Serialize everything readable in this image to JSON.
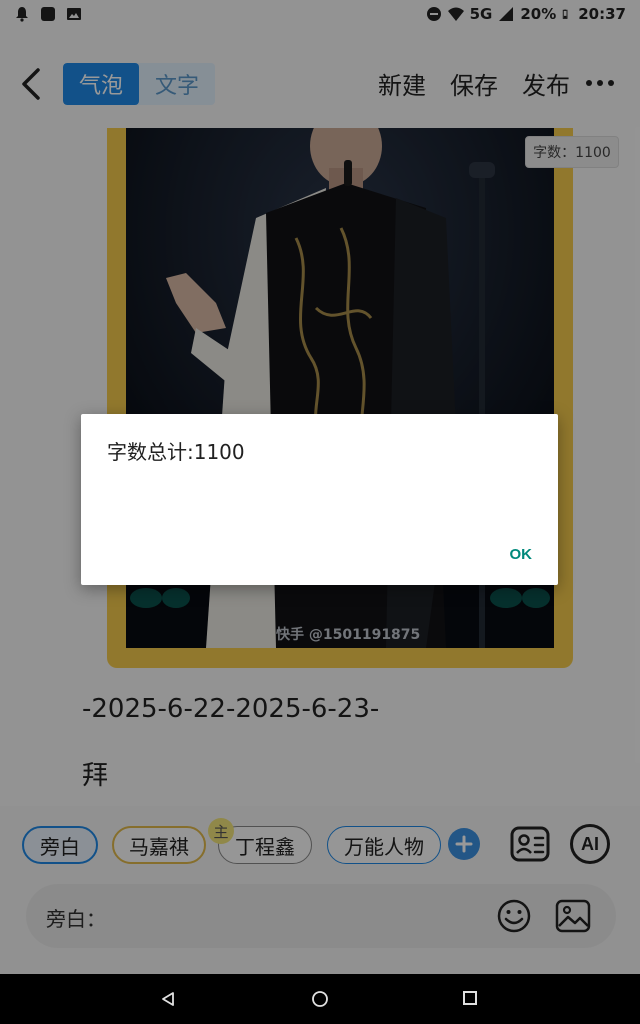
{
  "status_bar": {
    "network": "5G",
    "battery": "20%",
    "time": "20:37",
    "left_icons": [
      "notification-bell-icon",
      "square-app-icon",
      "gallery-icon"
    ],
    "right_icons": [
      "dnd-icon",
      "wifi-icon",
      "signal-icon",
      "battery-icon"
    ]
  },
  "top_bar": {
    "back_icon": "chevron-left-icon",
    "tabs": [
      {
        "label": "气泡",
        "active": true
      },
      {
        "label": "文字",
        "active": false
      }
    ],
    "actions": [
      {
        "label": "新建"
      },
      {
        "label": "保存"
      },
      {
        "label": "发布"
      }
    ],
    "more_icon": "more-horizontal-icon"
  },
  "photo": {
    "credit": "快手 @1501191875",
    "word_count_badge": "字数：1100"
  },
  "content": {
    "date_line": "-2025-6-22-2025-6-23-",
    "char_line": "拜"
  },
  "characters": {
    "chips": [
      {
        "label": "旁白"
      },
      {
        "label": "马嘉祺"
      },
      {
        "label": "丁程鑫",
        "badge": "主"
      },
      {
        "label": "万能人物"
      }
    ],
    "add_icon": "plus-icon",
    "contact_icon": "contact-card-icon",
    "ai_label": "AI"
  },
  "input": {
    "label": "旁白：",
    "emoji_icon": "emoji-icon",
    "image_icon": "image-icon"
  },
  "dialog": {
    "message": "字数总计:1100",
    "ok_label": "OK"
  },
  "nav_bar": {
    "icons": [
      "nav-back-icon",
      "nav-home-icon",
      "nav-recent-icon"
    ]
  },
  "colors": {
    "accent": "#1e88e5",
    "frame": "#f2c94c",
    "dialog_button": "#00897b",
    "overlay": "rgba(0,0,0,0.40)"
  }
}
